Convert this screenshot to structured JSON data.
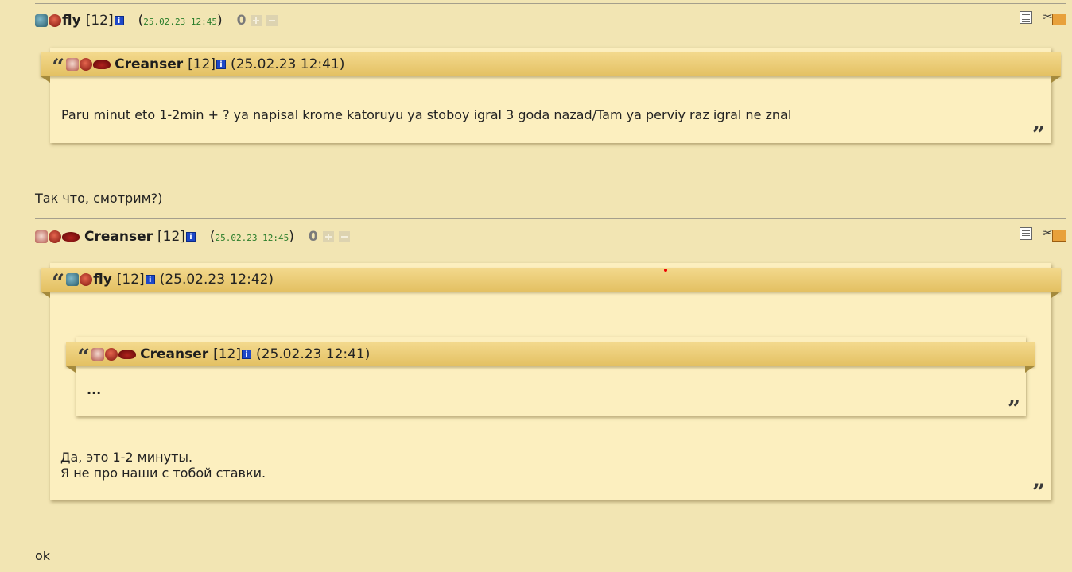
{
  "post1": {
    "author": "fly",
    "level": "[12]",
    "date_open": "(",
    "date": "25.02.23 12:45",
    "date_close": ")",
    "score": "0",
    "quote": {
      "author": "Creanser",
      "level": "[12]",
      "date": "(25.02.23 12:41)",
      "text": "Paru minut eto 1-2min + ? ya napisal krome katoruyu ya stoboy igral 3 goda nazad/Tam ya perviy raz igral ne znal"
    },
    "text": "Так что, смотрим?)"
  },
  "post2": {
    "author": "Creanser",
    "level": "[12]",
    "date_open": "(",
    "date": "25.02.23 12:45",
    "date_close": ")",
    "score": "0",
    "quote": {
      "author": "fly",
      "level": "[12]",
      "date": "(25.02.23 12:42)",
      "nested": {
        "author": "Creanser",
        "level": "[12]",
        "date": "(25.02.23 12:41)",
        "text": "..."
      },
      "line1": "Да, это 1-2 минуты.",
      "line2": "Я не про наши с тобой ставки."
    },
    "text": "ok"
  },
  "icons": {
    "info": "i",
    "open_quote": "“",
    "close_quote": "”"
  }
}
